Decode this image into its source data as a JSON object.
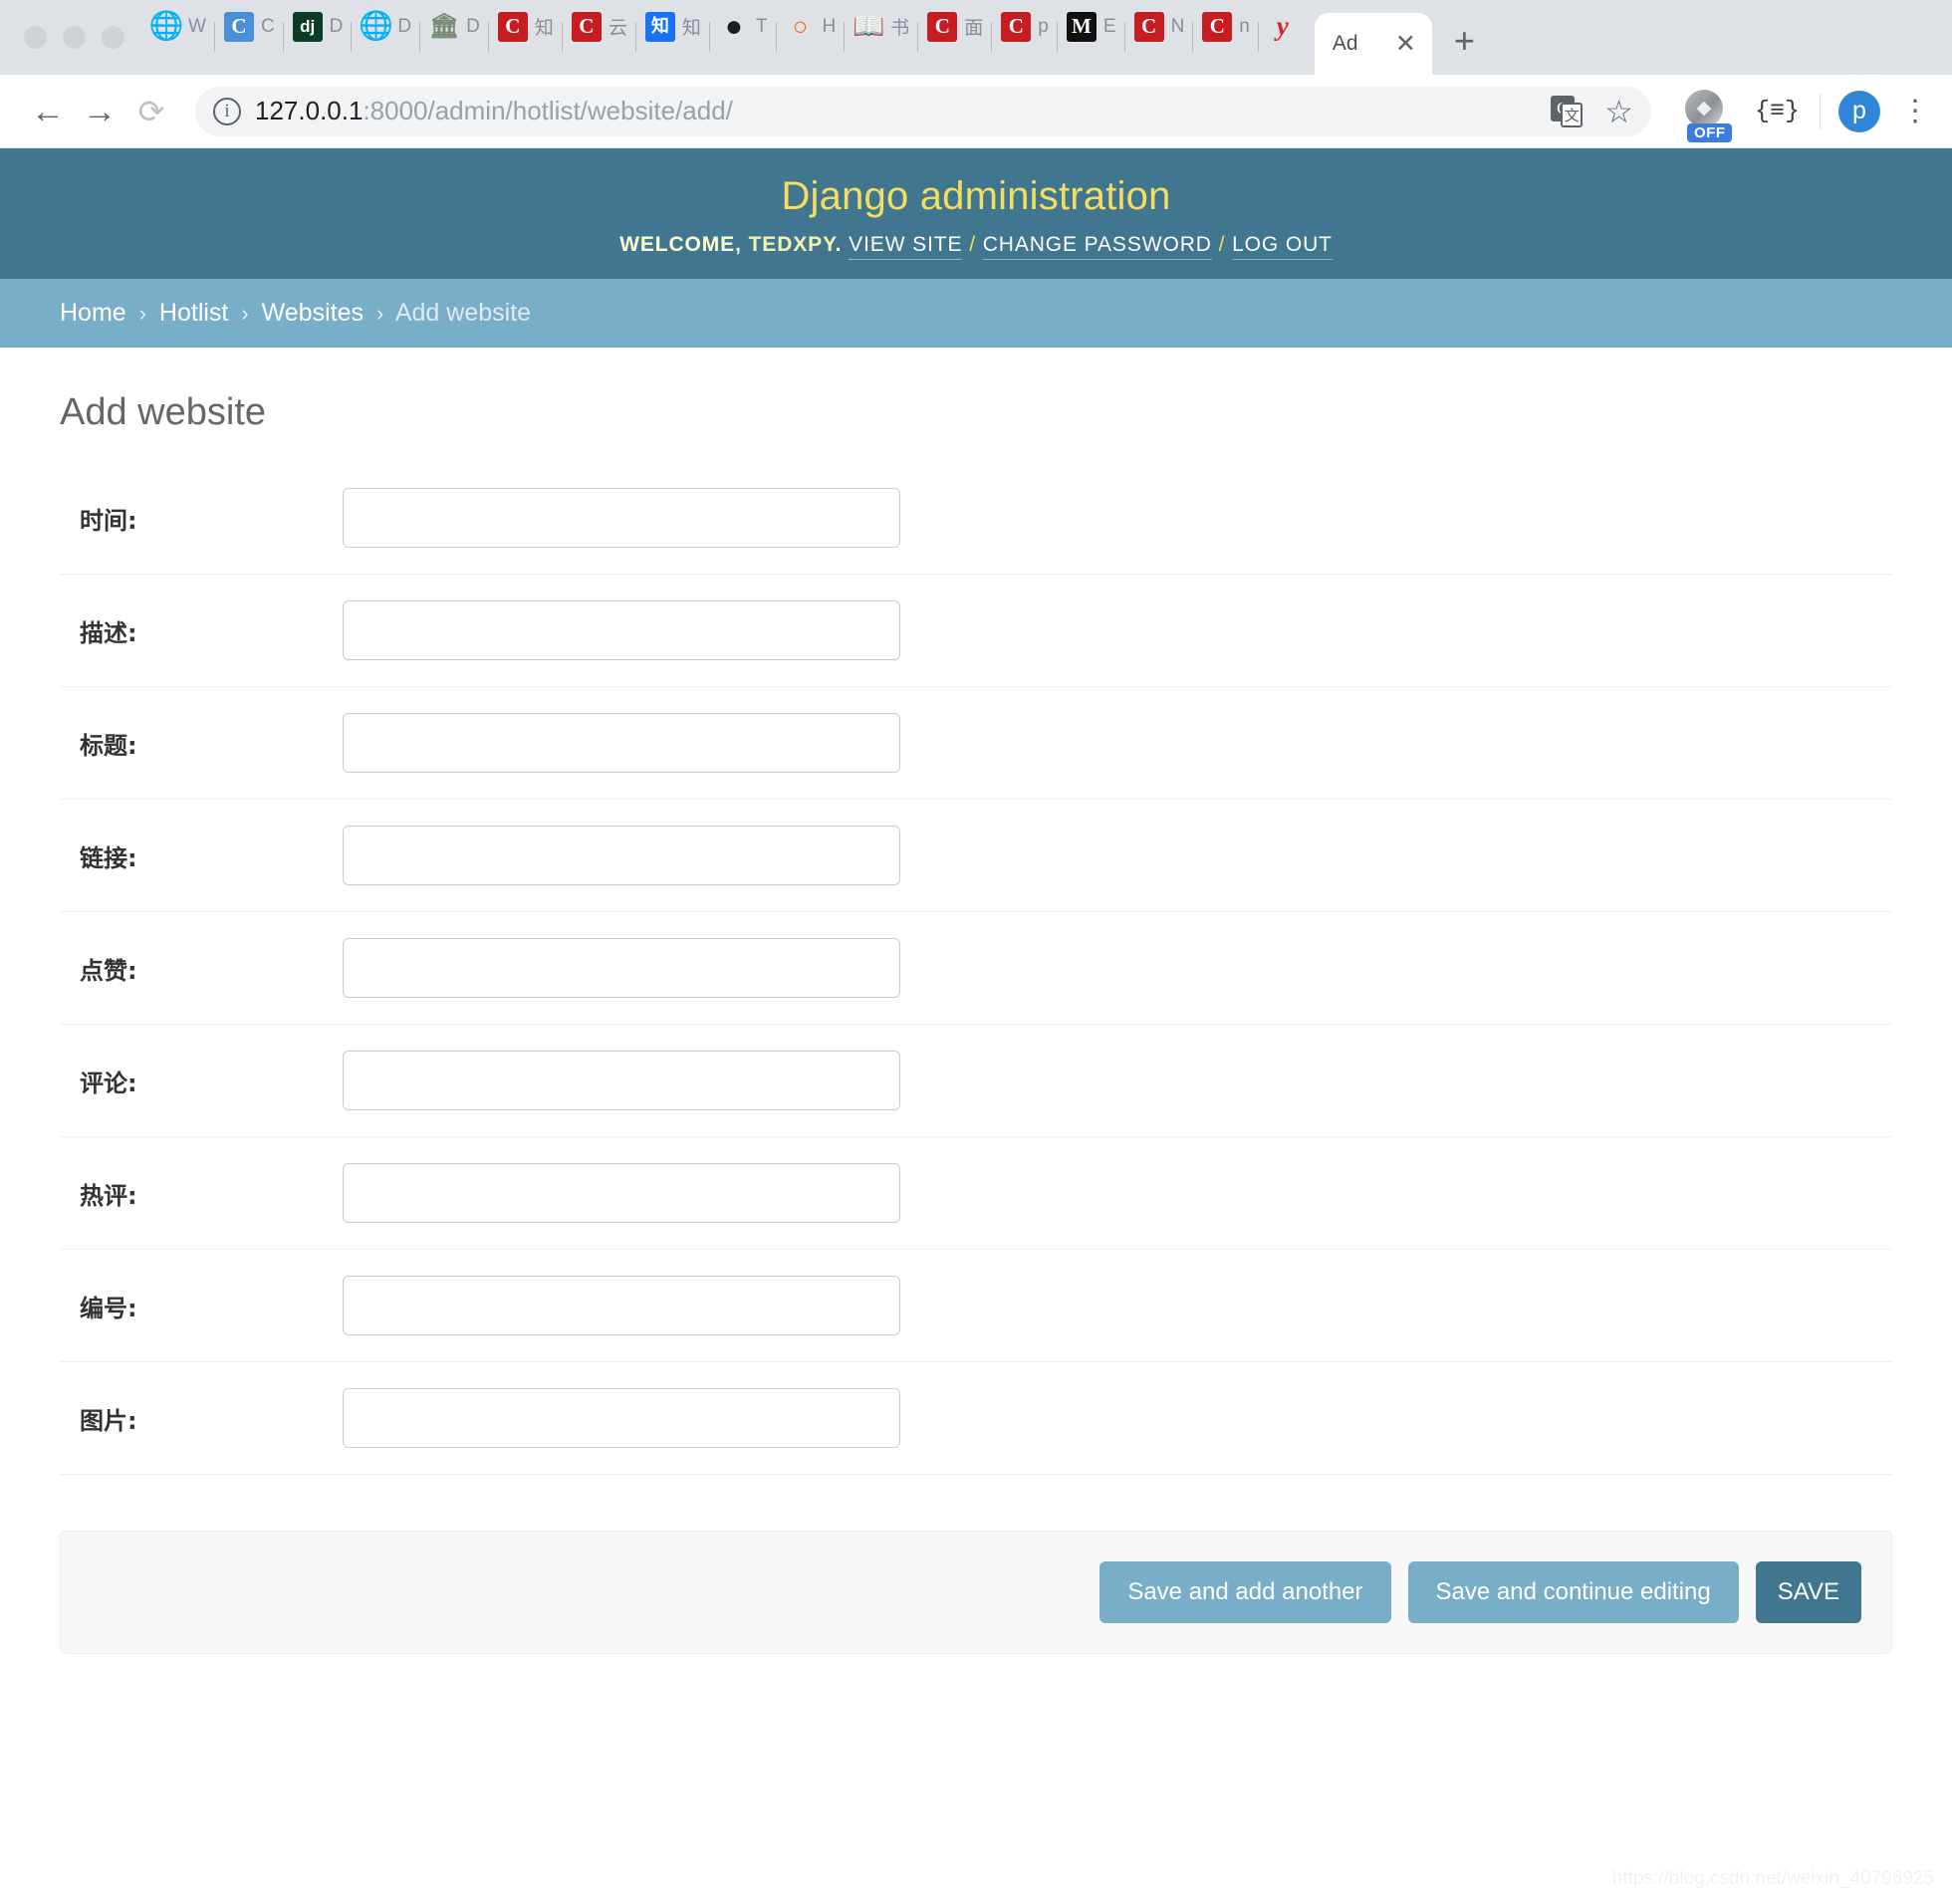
{
  "browser": {
    "window_controls": [
      "close",
      "minimize",
      "maximize"
    ],
    "tabs": [
      {
        "icon": "globe-icon",
        "label": "W"
      },
      {
        "icon": "c-blue-icon",
        "label": "C"
      },
      {
        "icon": "django-icon",
        "label": "D"
      },
      {
        "icon": "globe-icon",
        "label": "D"
      },
      {
        "icon": "bank-icon",
        "label": "D"
      },
      {
        "icon": "csdn-icon",
        "label": "知"
      },
      {
        "icon": "csdn-icon",
        "label": "云"
      },
      {
        "icon": "zhihu-icon",
        "label": "知"
      },
      {
        "icon": "github-icon",
        "label": "T"
      },
      {
        "icon": "arc-icon",
        "label": "H"
      },
      {
        "icon": "book-icon",
        "label": "书"
      },
      {
        "icon": "csdn-icon",
        "label": "面"
      },
      {
        "icon": "csdn-icon",
        "label": "p"
      },
      {
        "icon": "medium-icon",
        "label": "E"
      },
      {
        "icon": "csdn-icon",
        "label": "N"
      },
      {
        "icon": "csdn-icon",
        "label": "n"
      },
      {
        "icon": "yandex-icon",
        "label": "y"
      }
    ],
    "active_tab": {
      "title": "Ad",
      "close": "✕"
    },
    "new_tab_label": "+",
    "back_label": "←",
    "forward_label": "→",
    "reload_label": "⟳",
    "url": {
      "host": "127.0.0.1",
      "path": ":8000/admin/hotlist/website/add/",
      "full": "127.0.0.1:8000/admin/hotlist/website/add/"
    },
    "translate_icon": "G",
    "translate_icon2": "文",
    "bookmark_label": "☆",
    "extension_off_badge": "OFF",
    "extension_brace": "{≡}",
    "profile_initial": "p",
    "menu_label": "⋮"
  },
  "django": {
    "site_title": "Django administration",
    "user_tools": {
      "welcome_prefix": "WELCOME,",
      "username": "TEDXPY",
      "period": ".",
      "view_site": "VIEW SITE",
      "change_password": "CHANGE PASSWORD",
      "log_out": "LOG OUT",
      "separator": "/"
    },
    "breadcrumbs": [
      {
        "label": "Home",
        "link": true
      },
      {
        "label": "Hotlist",
        "link": true
      },
      {
        "label": "Websites",
        "link": true
      },
      {
        "label": "Add website",
        "link": false
      }
    ],
    "breadcrumb_separator": "›",
    "page_title": "Add website",
    "form": {
      "fields": [
        {
          "label": "时间:",
          "name": "shijian",
          "value": "",
          "placeholder": ""
        },
        {
          "label": "描述:",
          "name": "miaoshu",
          "value": "",
          "placeholder": ""
        },
        {
          "label": "标题:",
          "name": "biaoti",
          "value": "",
          "placeholder": ""
        },
        {
          "label": "链接:",
          "name": "lianjie",
          "value": "",
          "placeholder": ""
        },
        {
          "label": "点赞:",
          "name": "dianzan",
          "value": "",
          "placeholder": ""
        },
        {
          "label": "评论:",
          "name": "pinglun",
          "value": "",
          "placeholder": ""
        },
        {
          "label": "热评:",
          "name": "reping",
          "value": "",
          "placeholder": ""
        },
        {
          "label": "编号:",
          "name": "bianhao",
          "value": "",
          "placeholder": ""
        },
        {
          "label": "图片:",
          "name": "tupian",
          "value": "",
          "placeholder": ""
        }
      ]
    },
    "buttons": {
      "save_and_add_another": "Save and add another",
      "save_and_continue": "Save and continue editing",
      "save": "SAVE"
    },
    "colors": {
      "header_bg": "#417690",
      "header_title": "#f5dd5d",
      "breadcrumb_bg": "#79aec8",
      "button_bg": "#79aec8",
      "button_default_bg": "#417690"
    }
  },
  "watermark": "https://blog.csdn.net/weixin_40796925"
}
